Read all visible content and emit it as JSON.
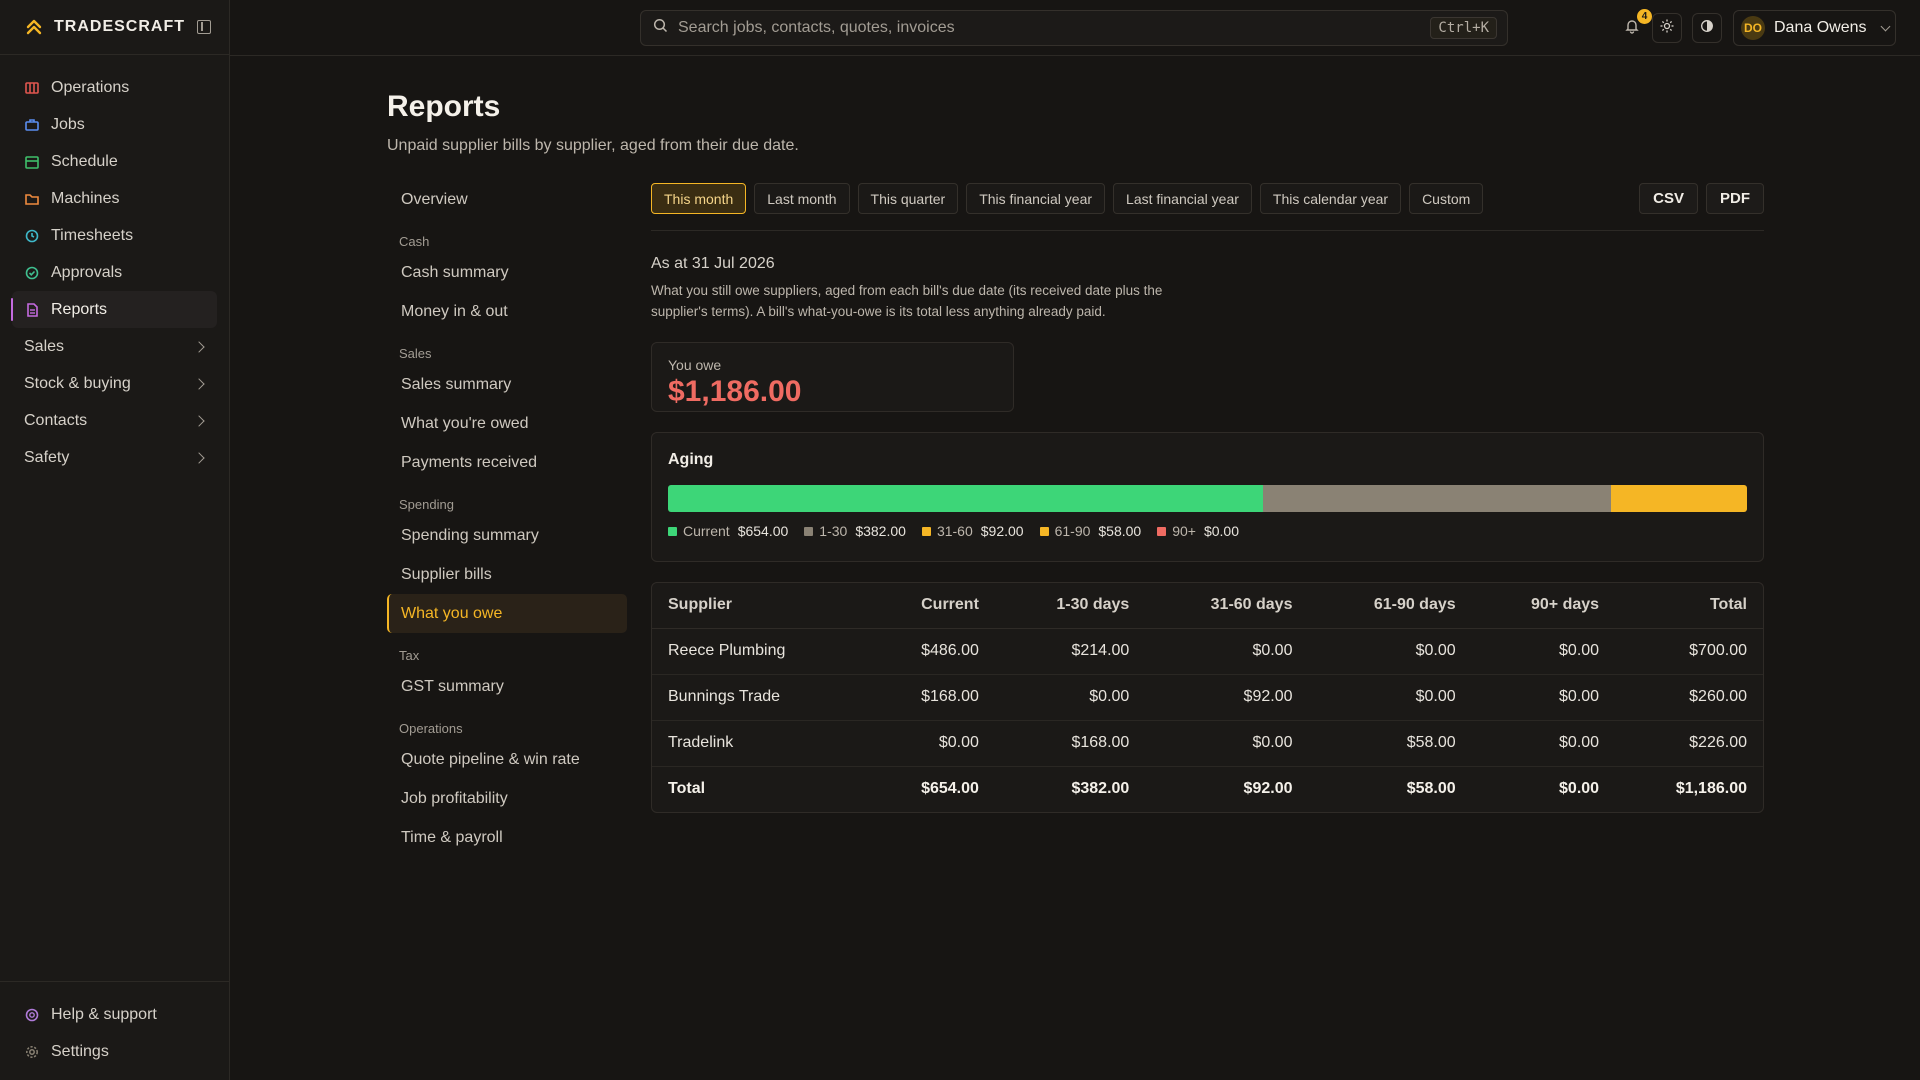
{
  "app": {
    "name": "TRADESCRAFT"
  },
  "sidebar": {
    "items": [
      {
        "label": "Operations",
        "icon": "operations-icon",
        "color": "#e0564f"
      },
      {
        "label": "Jobs",
        "icon": "jobs-icon",
        "color": "#5b8def"
      },
      {
        "label": "Schedule",
        "icon": "schedule-icon",
        "color": "#3fbf6a"
      },
      {
        "label": "Machines",
        "icon": "machines-icon",
        "color": "#ef8a3e"
      },
      {
        "label": "Timesheets",
        "icon": "timesheets-icon",
        "color": "#3fb8c9"
      },
      {
        "label": "Approvals",
        "icon": "approvals-icon",
        "color": "#3fbf8f"
      },
      {
        "label": "Reports",
        "icon": "reports-icon",
        "color": "#c46adf",
        "active": true
      }
    ],
    "groups": [
      {
        "label": "Sales"
      },
      {
        "label": "Stock & buying"
      },
      {
        "label": "Contacts"
      },
      {
        "label": "Safety"
      }
    ],
    "bottom": [
      {
        "label": "Help & support",
        "icon": "help-icon"
      },
      {
        "label": "Settings",
        "icon": "settings-icon"
      }
    ]
  },
  "topbar": {
    "search_placeholder": "Search jobs, contacts, quotes, invoices",
    "shortcut": "Ctrl+K",
    "notification_count": "4",
    "user": {
      "initials": "DO",
      "name": "Dana Owens"
    }
  },
  "page": {
    "title": "Reports",
    "subtitle": "Unpaid supplier bills by supplier, aged from their due date."
  },
  "report_nav": {
    "overview": "Overview",
    "sections": [
      {
        "heading": "Cash",
        "items": [
          "Cash summary",
          "Money in & out"
        ]
      },
      {
        "heading": "Sales",
        "items": [
          "Sales summary",
          "What you're owed",
          "Payments received"
        ]
      },
      {
        "heading": "Spending",
        "items": [
          "Spending summary",
          "Supplier bills",
          "What you owe"
        ]
      },
      {
        "heading": "Tax",
        "items": [
          "GST summary"
        ]
      },
      {
        "heading": "Operations",
        "items": [
          "Quote pipeline & win rate",
          "Job profitability",
          "Time & payroll"
        ]
      }
    ],
    "active": "What you owe"
  },
  "filters": {
    "options": [
      "This month",
      "Last month",
      "This quarter",
      "This financial year",
      "Last financial year",
      "This calendar year",
      "Custom"
    ],
    "selected": "This month"
  },
  "exports": {
    "csv": "CSV",
    "pdf": "PDF"
  },
  "report": {
    "as_at": "As at 31 Jul 2026",
    "explanation": "What you still owe suppliers, aged from each bill's due date (its received date plus the supplier's terms). A bill's what-you-owe is its total less anything already paid.",
    "you_owe_label": "You owe",
    "you_owe_amount": "$1,186.00",
    "aging": {
      "title": "Aging",
      "buckets": [
        {
          "label": "Current",
          "amount": "$654.00",
          "value": 654,
          "color": "#3dd678"
        },
        {
          "label": "1-30",
          "amount": "$382.00",
          "value": 382,
          "color": "#8a8274"
        },
        {
          "label": "31-60",
          "amount": "$92.00",
          "value": 92,
          "color": "#f5b625"
        },
        {
          "label": "61-90",
          "amount": "$58.00",
          "value": 58,
          "color": "#f5b625"
        },
        {
          "label": "90+",
          "amount": "$0.00",
          "value": 0,
          "color": "#ef6b62"
        }
      ]
    },
    "table": {
      "columns": [
        "Supplier",
        "Current",
        "1-30 days",
        "31-60 days",
        "61-90 days",
        "90+ days",
        "Total"
      ],
      "rows": [
        [
          "Reece Plumbing",
          "$486.00",
          "$214.00",
          "$0.00",
          "$0.00",
          "$0.00",
          "$700.00"
        ],
        [
          "Bunnings Trade",
          "$168.00",
          "$0.00",
          "$92.00",
          "$0.00",
          "$0.00",
          "$260.00"
        ],
        [
          "Tradelink",
          "$0.00",
          "$168.00",
          "$0.00",
          "$58.00",
          "$0.00",
          "$226.00"
        ]
      ],
      "total": [
        "Total",
        "$654.00",
        "$382.00",
        "$92.00",
        "$58.00",
        "$0.00",
        "$1,186.00"
      ]
    }
  }
}
